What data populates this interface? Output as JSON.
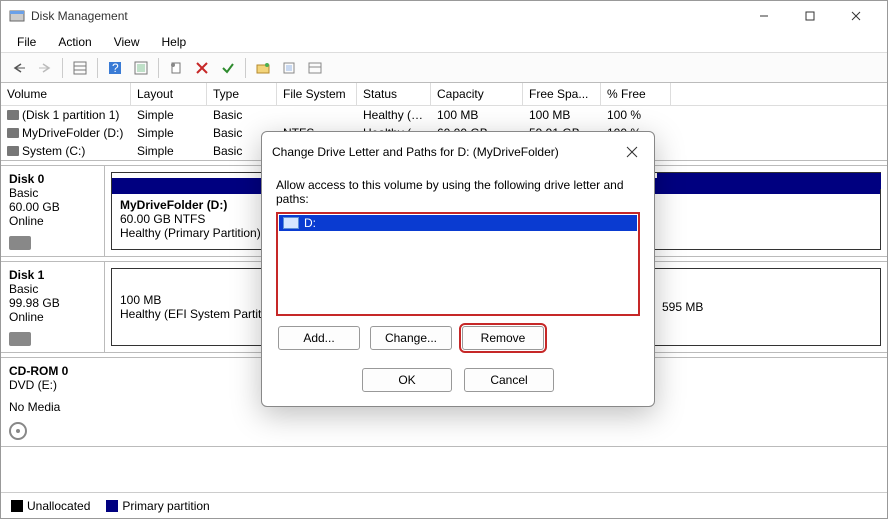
{
  "window": {
    "title": "Disk Management"
  },
  "menu": {
    "file": "File",
    "action": "Action",
    "view": "View",
    "help": "Help"
  },
  "columns": {
    "volume": "Volume",
    "layout": "Layout",
    "type": "Type",
    "fs": "File System",
    "status": "Status",
    "capacity": "Capacity",
    "free": "Free Spa...",
    "pfree": "% Free"
  },
  "volumes": [
    {
      "name": "(Disk 1 partition 1)",
      "layout": "Simple",
      "type": "Basic",
      "fs": "",
      "status": "Healthy (E...",
      "capacity": "100 MB",
      "free": "100 MB",
      "pfree": "100 %"
    },
    {
      "name": "MyDriveFolder (D:)",
      "layout": "Simple",
      "type": "Basic",
      "fs": "NTFS",
      "status": "Healthy (P...",
      "capacity": "60.00 GB",
      "free": "59.91 GB",
      "pfree": "100 %"
    },
    {
      "name": "System (C:)",
      "layout": "Simple",
      "type": "Basic",
      "fs": "",
      "status": "",
      "capacity": "",
      "free": "",
      "pfree": ""
    }
  ],
  "disks": {
    "d0": {
      "name": "Disk 0",
      "type": "Basic",
      "size": "60.00 GB",
      "state": "Online",
      "p0_name": "MyDriveFolder  (D:)",
      "p0_sub": "60.00 GB NTFS",
      "p0_stat": "Healthy (Primary Partition)"
    },
    "d1": {
      "name": "Disk 1",
      "type": "Basic",
      "size": "99.98 GB",
      "state": "Online",
      "p0_sub": "100 MB",
      "p0_stat": "Healthy (EFI System Partiti",
      "p1_sub": "595 MB"
    },
    "cd": {
      "name": "CD-ROM 0",
      "type": "DVD (E:)",
      "state": "No Media"
    }
  },
  "legend": {
    "unalloc": "Unallocated",
    "primary": "Primary partition"
  },
  "dialog": {
    "title": "Change Drive Letter and Paths for D: (MyDriveFolder)",
    "hint": "Allow access to this volume by using the following drive letter and paths:",
    "entry": "D:",
    "add": "Add...",
    "change": "Change...",
    "remove": "Remove",
    "ok": "OK",
    "cancel": "Cancel"
  },
  "colors": {
    "primary_stripe": "#000080",
    "unalloc": "#000000",
    "highlight": "#c62828"
  }
}
